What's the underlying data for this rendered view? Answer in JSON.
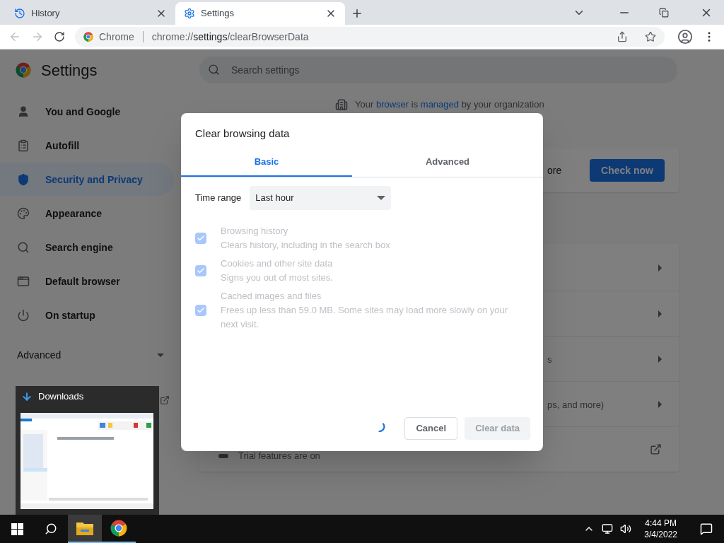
{
  "browser": {
    "tabs": [
      {
        "title": "History",
        "selected": false
      },
      {
        "title": "Settings",
        "selected": true
      }
    ],
    "address": {
      "site_label": "Chrome",
      "scheme": "chrome://",
      "host": "settings",
      "path": "/clearBrowserData"
    }
  },
  "settings": {
    "title": "Settings",
    "search_placeholder": "Search settings",
    "sidebar": {
      "items": [
        {
          "label": "You and Google",
          "selected": false
        },
        {
          "label": "Autofill",
          "selected": false
        },
        {
          "label": "Security and Privacy",
          "selected": true
        },
        {
          "label": "Appearance",
          "selected": false
        },
        {
          "label": "Search engine",
          "selected": false
        },
        {
          "label": "Default browser",
          "selected": false
        },
        {
          "label": "On startup",
          "selected": false
        }
      ],
      "advanced": {
        "label": "Advanced",
        "expanded": false
      }
    },
    "managed_notice": {
      "prefix": "Your",
      "link_1": "browser",
      "middle": "is",
      "link_2": "managed",
      "suffix": "by your organization"
    },
    "safety_check": {
      "fragment": "ore",
      "button": "Check now"
    },
    "privacy_rows": [
      {
        "kind": "arrow"
      },
      {
        "kind": "arrow"
      },
      {
        "kind": "arrow",
        "fragment": "s"
      },
      {
        "kind": "arrow",
        "fragment": "ps, and more)"
      },
      {
        "kind": "external",
        "text": "Trial features are on"
      }
    ]
  },
  "dialog": {
    "title": "Clear browsing data",
    "tabs": [
      {
        "label": "Basic",
        "selected": true
      },
      {
        "label": "Advanced",
        "selected": false
      }
    ],
    "time_range": {
      "label": "Time range",
      "value": "Last hour"
    },
    "options": [
      {
        "title": "Browsing history",
        "description": "Clears history, including in the search box",
        "checked": true,
        "disabled": true
      },
      {
        "title": "Cookies and other site data",
        "description": "Signs you out of most sites.",
        "checked": true,
        "disabled": true
      },
      {
        "title": "Cached images and files",
        "description": "Frees up less than 59.0 MB. Some sites may load more slowly on your next visit.",
        "checked": true,
        "disabled": true
      }
    ],
    "busy": true,
    "buttons": [
      {
        "label": "Cancel",
        "kind": "secondary",
        "disabled": false
      },
      {
        "label": "Clear data",
        "kind": "primary",
        "disabled": true
      }
    ]
  },
  "downloads_preview": {
    "title": "Downloads"
  },
  "taskbar": {
    "apps": [
      {
        "kind": "explorer",
        "selected": true
      },
      {
        "kind": "chrome",
        "selected": false
      }
    ],
    "time": "4:44 PM",
    "date": "3/4/2022"
  }
}
